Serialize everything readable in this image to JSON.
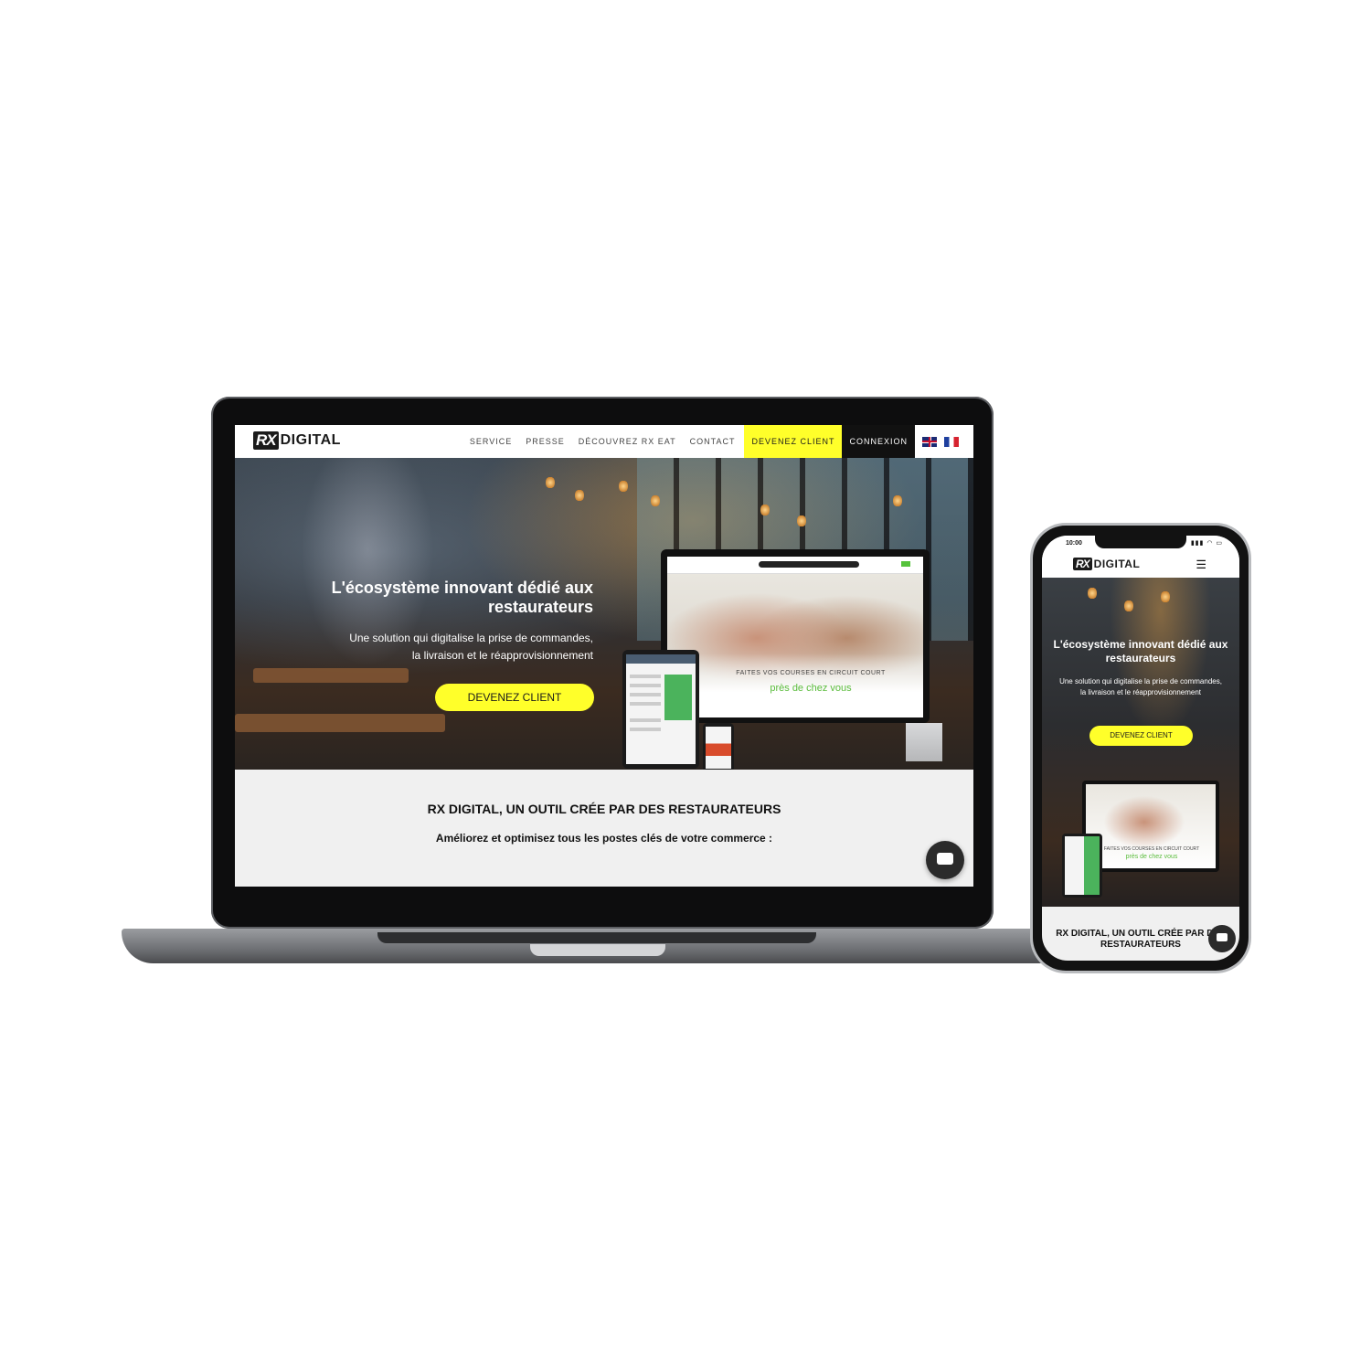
{
  "laptop": {
    "logo": {
      "mark": "RX",
      "word": "DIGITAL"
    },
    "nav": {
      "items": [
        "SERVICE",
        "PRESSE",
        "DÉCOUVREZ RX EAT",
        "CONTACT"
      ],
      "cta": "DEVENEZ CLIENT",
      "login": "CONNEXION",
      "languages": [
        "uk-flag-icon",
        "fr-flag-icon"
      ]
    },
    "hero": {
      "title": "L'écosystème innovant dédié aux restaurateurs",
      "subtitle_line1": "Une solution qui digitalise la prise de commandes,",
      "subtitle_line2": "la livraison et le réapprovisionnement",
      "button": "DEVENEZ CLIENT",
      "mockup": {
        "promo_line1": "FAITES VOS COURSES EN CIRCUIT COURT",
        "promo_line2": "près de chez vous"
      }
    },
    "section2": {
      "title": "RX DIGITAL, UN OUTIL CRÉE PAR DES RESTAURATEURS",
      "subtitle": "Améliorez et optimisez  tous les postes clés de votre commerce  :"
    },
    "chat_icon": "chat-bubble-icon"
  },
  "phone": {
    "status_time": "10:00",
    "status_icons": "▮▮▮ ◠ ▭",
    "logo": {
      "mark": "RX",
      "word": "DIGITAL"
    },
    "menu_icon": "☰",
    "hero": {
      "title": "L'écosystème innovant dédié aux restaurateurs",
      "subtitle_line1": "Une solution qui digitalise la prise de commandes,",
      "subtitle_line2": "la livraison et le réapprovisionnement",
      "button": "DEVENEZ CLIENT",
      "mockup": {
        "promo_line1": "FAITES VOS COURSES EN CIRCUIT COURT",
        "promo_line2": "près de chez vous"
      }
    },
    "section2_title": "RX DIGITAL, UN OUTIL CRÉE PAR DES RESTAURATEURS"
  },
  "colors": {
    "accent_yellow": "#ffff2a",
    "dark": "#111111",
    "promo_green": "#5bbd3d"
  }
}
